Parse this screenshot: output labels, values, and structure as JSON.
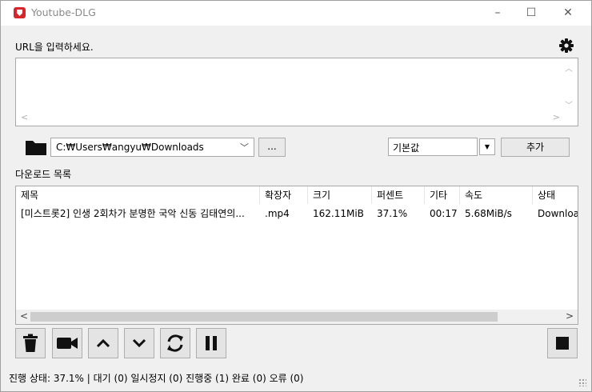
{
  "window": {
    "title": "Youtube-DLG",
    "minimize": "–",
    "maximize": "☐",
    "close": "✕"
  },
  "url": {
    "label": "URL을 입력하세요."
  },
  "path": {
    "value": "C:₩Users₩angyu₩Downloads",
    "browse_label": "..."
  },
  "format": {
    "selected": "기본값"
  },
  "add_label": "추가",
  "download_list": {
    "label": "다운로드 목록",
    "columns": [
      "제목",
      "확장자",
      "크기",
      "퍼센트",
      "기타",
      "속도",
      "상태"
    ],
    "rows": [
      {
        "title": "[미스트롯2] 인생 2회차가 분명한 국악 신동 김태연의...",
        "ext": ".mp4",
        "size": "162.11MiB",
        "percent": "37.1%",
        "eta": "00:17",
        "speed": "5.68MiB/s",
        "status": "Downloading"
      }
    ]
  },
  "toolbar": {
    "icons": [
      "trash-icon",
      "video-camera-icon",
      "arrow-up-icon",
      "arrow-down-icon",
      "reload-icon",
      "pause-icon",
      "stop-icon"
    ]
  },
  "status_bar": "진행 상태: 37.1% | 대기 (0) 일시정지 (0) 진행중 (1) 완료 (0) 오류 (0)",
  "colors": {
    "accent": "#d6262b",
    "background": "#f0f0f0"
  }
}
